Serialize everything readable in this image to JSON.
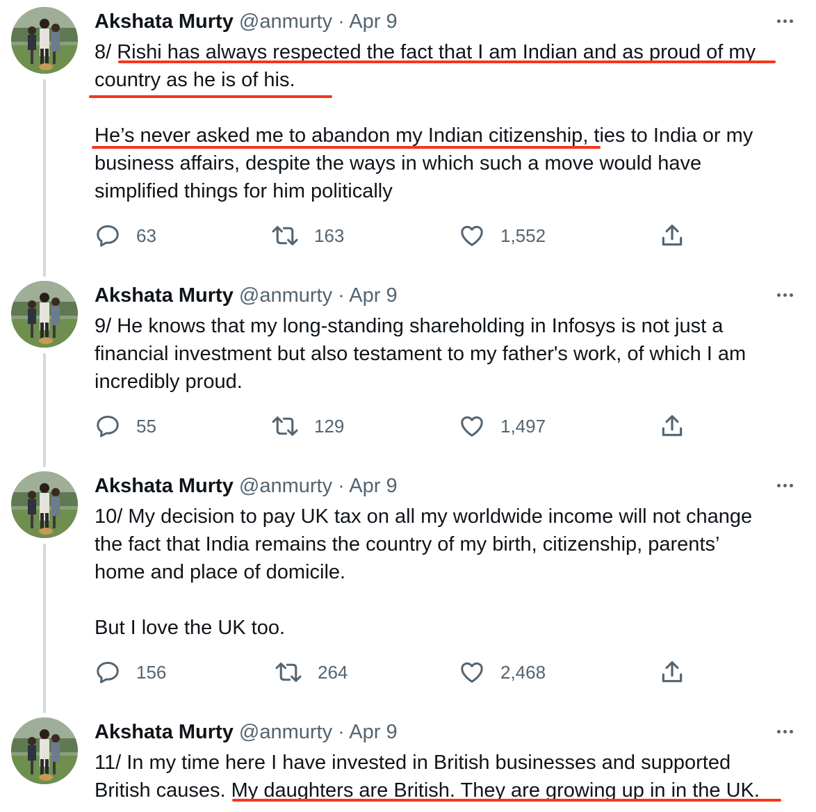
{
  "tweets": [
    {
      "author_name": "Akshata Murty",
      "handle_date": "@anmurty · Apr 9",
      "paragraphs": [
        [
          "8/ Rishi has always respected the fact that I am Indian and as proud of my",
          "country as he is of his."
        ],
        [
          "He’s never asked me to abandon my Indian citizenship, ties to India or my",
          "business affairs, despite the ways in which such a move would have",
          "simplified things for him politically"
        ]
      ],
      "replies": "63",
      "retweets": "163",
      "likes": "1,552"
    },
    {
      "author_name": "Akshata Murty",
      "handle_date": "@anmurty · Apr 9",
      "paragraphs": [
        [
          "9/ He knows that my long-standing shareholding in Infosys is not just a",
          "financial investment but also testament to my father's work, of which I am",
          "incredibly proud."
        ]
      ],
      "replies": "55",
      "retweets": "129",
      "likes": "1,497"
    },
    {
      "author_name": "Akshata Murty",
      "handle_date": "@anmurty · Apr 9",
      "paragraphs": [
        [
          "10/ My decision to pay UK tax on all my worldwide income will not change",
          "the fact that India remains the country of my birth, citizenship, parents’",
          "home and place of domicile."
        ],
        [
          "But I love the UK too."
        ]
      ],
      "replies": "156",
      "retweets": "264",
      "likes": "2,468"
    },
    {
      "author_name": "Akshata Murty",
      "handle_date": "@anmurty · Apr 9",
      "paragraphs": [
        [
          "11/ In my time here I have invested in British businesses and supported",
          "British causes. My daughters are British. They are growing up in in the UK."
        ]
      ]
    }
  ],
  "colors": {
    "text": "#0f1419",
    "secondary": "#536471",
    "thread_line": "#cfd9de",
    "annotation_underline": "#f5371b"
  },
  "icons": {
    "reply": "speech-bubble-icon",
    "retweet": "retweet-arrows-icon",
    "like": "heart-outline-icon",
    "share": "share-upload-icon",
    "more": "ellipsis-icon"
  }
}
